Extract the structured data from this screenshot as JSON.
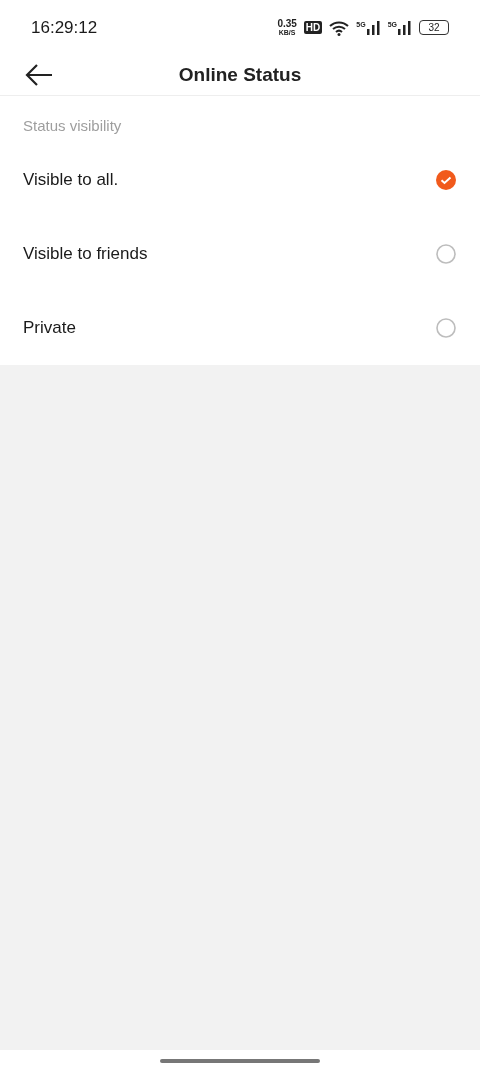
{
  "status_bar": {
    "time": "16:29:12",
    "speed_value": "0.35",
    "speed_unit": "KB/S",
    "hd_badge": "HD",
    "sim_1": "5G",
    "sim_2": "5G",
    "battery": "32"
  },
  "header": {
    "title": "Online Status"
  },
  "section": {
    "label": "Status visibility"
  },
  "options": [
    {
      "label": "Visible to all.",
      "selected": true
    },
    {
      "label": "Visible to friends",
      "selected": false
    },
    {
      "label": "Private",
      "selected": false
    }
  ]
}
